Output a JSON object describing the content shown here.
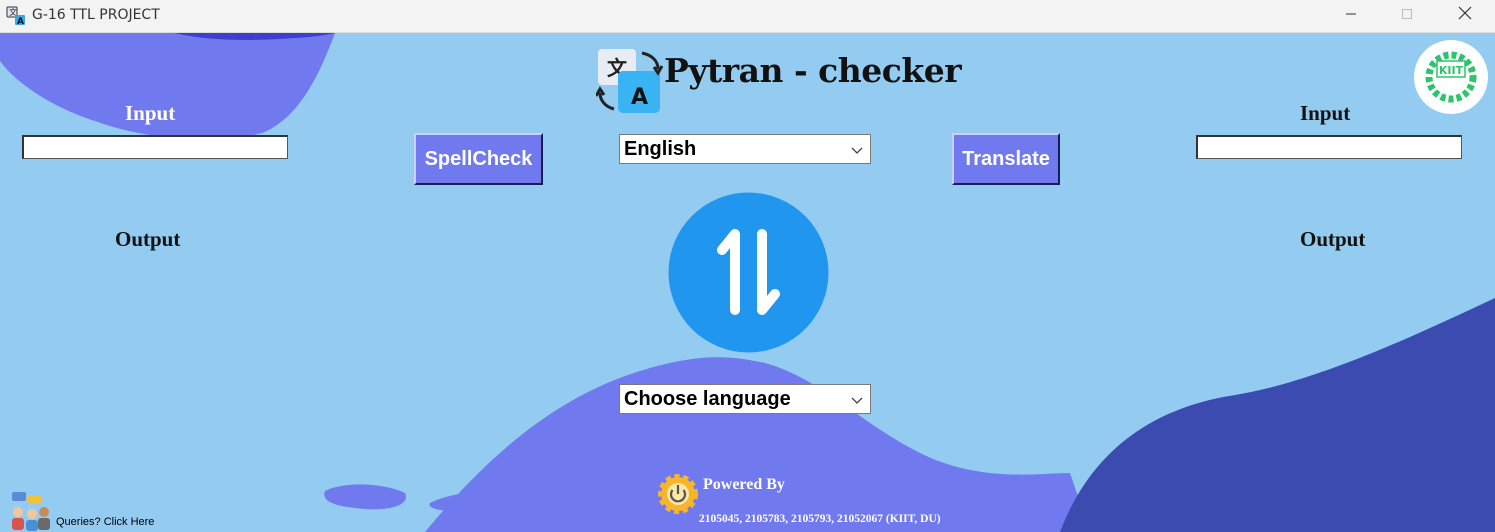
{
  "window": {
    "title": "G-16 TTL PROJECT"
  },
  "app": {
    "title": "Pytran - checker"
  },
  "left_panel": {
    "input_label": "Input",
    "input_value": "",
    "output_label": "Output"
  },
  "right_panel": {
    "input_label": "Input",
    "input_value": "",
    "output_label": "Output"
  },
  "buttons": {
    "spellcheck": "SpellCheck",
    "translate": "Translate"
  },
  "source_language": {
    "selected": "English"
  },
  "target_language": {
    "selected": "Choose language"
  },
  "footer": {
    "powered_by": "Powered By",
    "credits": "2105045, 2105783, 2105793, 21052067 (KIIT, DU)",
    "queries": "Queries? Click Here"
  },
  "logo": {
    "text": "KIIT"
  },
  "colors": {
    "background": "#94cbf1",
    "blob_light": "#7179ef",
    "blob_dark": "#3b4bb0",
    "button": "#7179ef",
    "swap_circle": "#2196ee"
  },
  "icons": {
    "app": "translate-icon",
    "swap": "swap-vertical-icon",
    "powered": "power-gear-icon",
    "queries": "chat-people-icon",
    "logo": "kiit-logo"
  }
}
